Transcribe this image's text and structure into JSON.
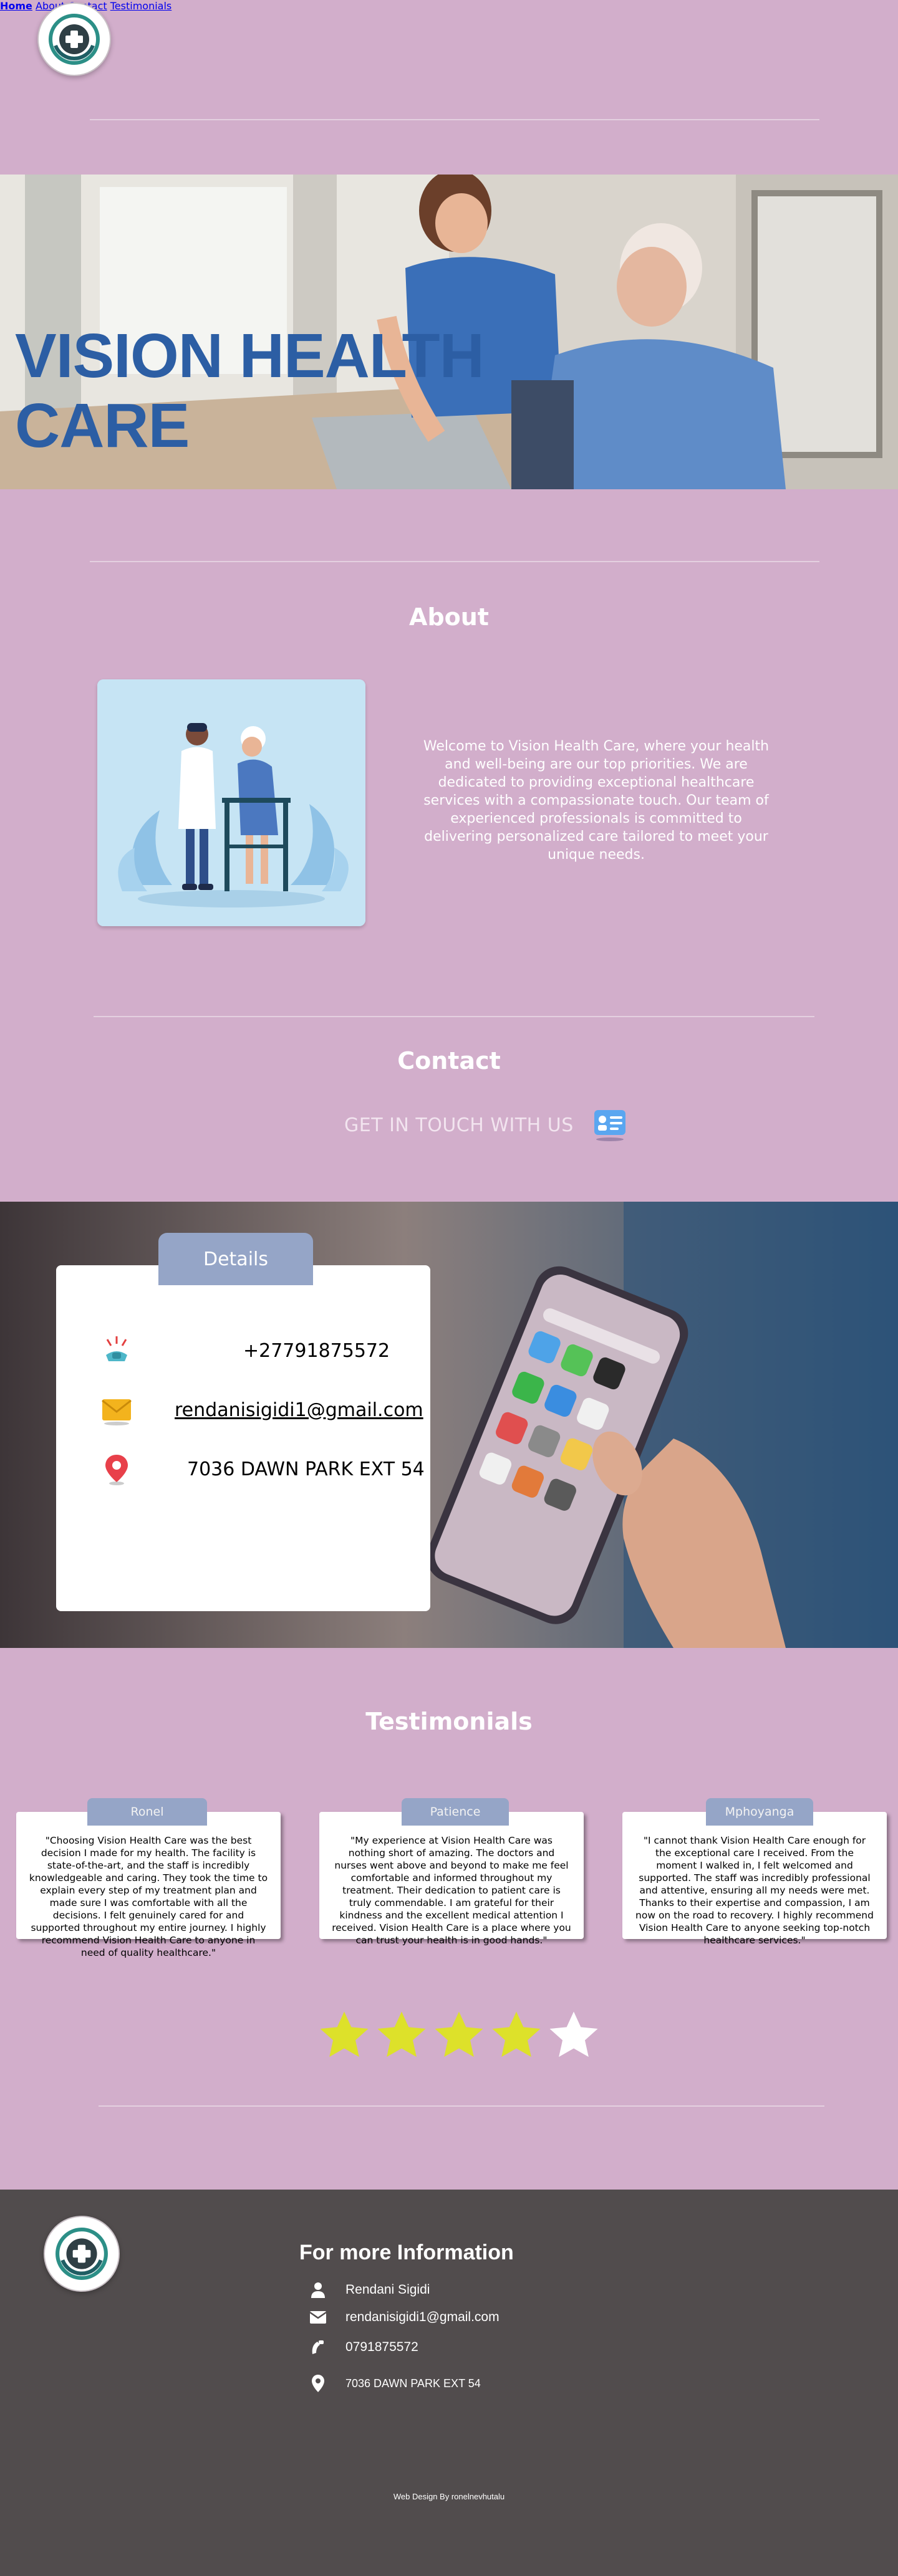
{
  "nav": {
    "home": "Home",
    "about": "About",
    "contact": "Contact",
    "testimonials": "Testimonials"
  },
  "hero": {
    "title": "VISION HEALTH CARE"
  },
  "about": {
    "title": "About",
    "text": "Welcome to Vision Health Care, where your health and well-being are our top priorities. We are dedicated to providing exceptional healthcare services with a compassionate touch. Our team of experienced professionals is committed to delivering personalized care tailored to meet your unique needs."
  },
  "contact": {
    "title": "Contact",
    "touch": "GET IN TOUCH WITH US",
    "details_tab": "Details",
    "phone": "+27791875572",
    "email": "rendanisigidi1@gmail.com",
    "address": "7036 DAWN PARK EXT 54"
  },
  "testimonials": {
    "title": "Testimonials",
    "items": [
      {
        "name": "Ronel",
        "text": "\"Choosing Vision Health Care was the best decision I made for my health. The facility is state-of-the-art, and the staff is incredibly knowledgeable and caring. They took the time to explain every step of my treatment plan and made sure I was comfortable with all the decisions. I felt genuinely cared for and supported throughout my entire journey. I highly recommend Vision Health Care to anyone in need of quality healthcare.\""
      },
      {
        "name": "Patience",
        "text": "\"My experience at Vision Health Care was nothing short of amazing. The doctors and nurses went above and beyond to make me feel comfortable and informed throughout my treatment. Their dedication to patient care is truly commendable. I am grateful for their kindness and the excellent medical attention I received. Vision Health Care is a place where you can trust your health is in good hands.\""
      },
      {
        "name": "Mphoyanga",
        "text": "\"I cannot thank Vision Health Care enough for the exceptional care I received. From the moment I walked in, I felt welcomed and supported. The staff was incredibly professional and attentive, ensuring all my needs were met. Thanks to their expertise and compassion, I am now on the road to recovery. I highly recommend Vision Health Care to anyone seeking top-notch healthcare services.\""
      }
    ],
    "rating": 4,
    "rating_max": 5,
    "star_color": "#dde12a"
  },
  "footer": {
    "heading": "For more Information",
    "name": "Rendani Sigidi",
    "email": "rendanisigidi1@gmail.com",
    "phone": "0791875572",
    "address": "7036 DAWN PARK EXT 54",
    "credit": "Web Design By ronelnevhutalu"
  },
  "colors": {
    "background": "#d2aecb",
    "hero_title": "#2c5ea4",
    "tab": "#95a5c7",
    "footer": "#514c4d"
  }
}
